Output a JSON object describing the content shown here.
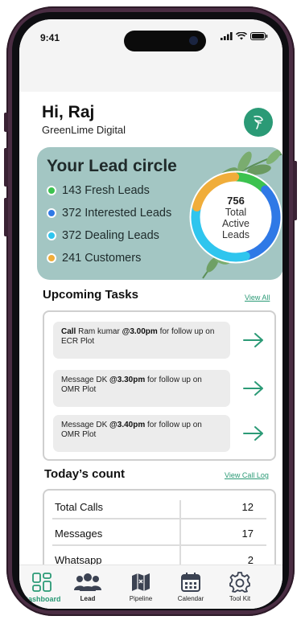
{
  "status_bar": {
    "time": "9:41"
  },
  "header": {
    "greeting": "Hi, Raj",
    "organization": "GreenLime Digital"
  },
  "lead_circle": {
    "title": "Your Lead circle",
    "items": [
      {
        "label": "143 Fresh Leads",
        "color": "#3cc24f"
      },
      {
        "label": "372 Interested Leads",
        "color": "#2f79e6"
      },
      {
        "label": "372 Dealing Leads",
        "color": "#2fc5ee"
      },
      {
        "label": "241 Customers",
        "color": "#f0ad3a"
      }
    ],
    "total_number": "756",
    "total_label_1": "Total",
    "total_label_2": "Active",
    "total_label_3": "Leads",
    "segments": [
      143,
      372,
      372,
      241
    ]
  },
  "tasks": {
    "title": "Upcoming Tasks",
    "view_all": "View All",
    "items": [
      {
        "verb": "Call",
        "text1": " Ram kumar ",
        "time": "@3.00pm",
        "text2": " for follow up on ECR Plot"
      },
      {
        "verb": "Message DK ",
        "text1": "",
        "time": "@3.30pm",
        "text2": " for follow up on OMR Plot"
      },
      {
        "verb": "Message DK ",
        "text1": "",
        "time": "@3.40pm",
        "text2": " for follow up on OMR Plot"
      }
    ]
  },
  "counts": {
    "title": "Today’s count",
    "view_log": "View Call Log",
    "rows": [
      {
        "label": "Total Calls",
        "value": "12"
      },
      {
        "label": "Messages",
        "value": "17"
      },
      {
        "label": "Whatsapp",
        "value": "2"
      }
    ]
  },
  "nav": {
    "items": [
      {
        "label": "Dashboard",
        "icon": "dashboard-icon"
      },
      {
        "label": "Lead",
        "icon": "users-icon"
      },
      {
        "label": "Pipeline",
        "icon": "map-icon"
      },
      {
        "label": "Calendar",
        "icon": "calendar-icon"
      },
      {
        "label": "Tool Kit",
        "icon": "gear-icon"
      }
    ]
  },
  "colors": {
    "accent": "#2b9a76",
    "card": "#a3c6c3"
  }
}
